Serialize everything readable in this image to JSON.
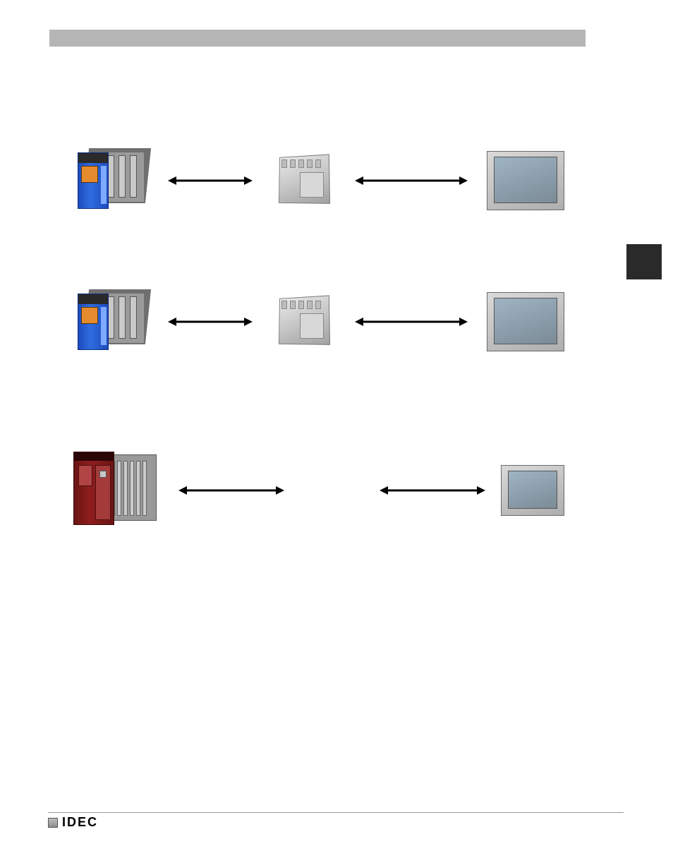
{
  "header": {
    "band_color": "#b5b5b5"
  },
  "side_tab": {
    "color": "#2a2a2a"
  },
  "diagrams": [
    {
      "left_device": {
        "type": "plc",
        "color": "blue"
      },
      "center_device": {
        "type": "module"
      },
      "right_device": {
        "type": "hmi"
      }
    },
    {
      "left_device": {
        "type": "plc",
        "color": "blue"
      },
      "center_device": {
        "type": "module"
      },
      "right_device": {
        "type": "hmi"
      }
    },
    {
      "left_device": {
        "type": "plc",
        "color": "red"
      },
      "center_device": null,
      "right_device": {
        "type": "hmi"
      }
    }
  ],
  "footer": {
    "brand": "IDEC"
  }
}
